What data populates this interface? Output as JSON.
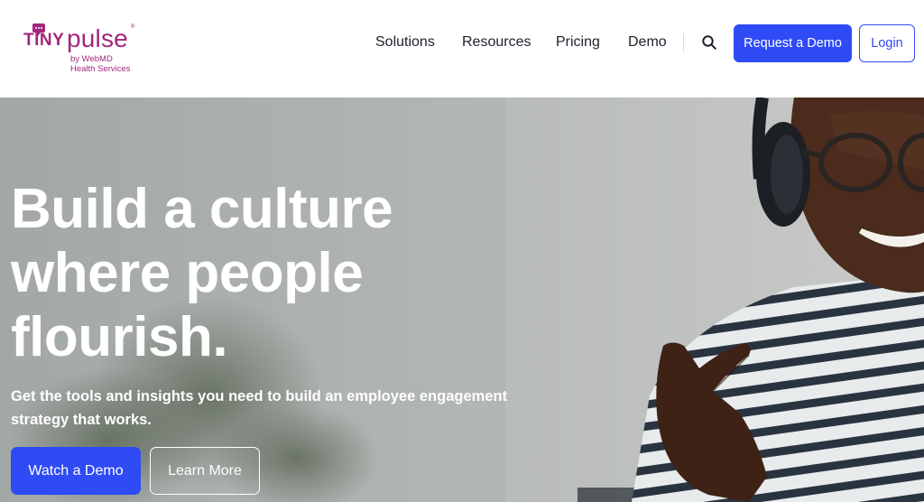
{
  "brand": {
    "logo_word_1": "TINY",
    "logo_word_2": "pulse",
    "logo_mark": "®",
    "logo_by_line_1": "by WebMD",
    "logo_by_line_2": "Health Services",
    "color": "#a3267e"
  },
  "nav": {
    "items": [
      {
        "label": "Solutions"
      },
      {
        "label": "Resources"
      },
      {
        "label": "Pricing"
      },
      {
        "label": "Demo"
      }
    ],
    "search_icon": "search-icon",
    "request_demo_label": "Request a Demo",
    "login_label": "Login"
  },
  "hero": {
    "title_lines": [
      "Build a culture",
      "where people",
      "flourish."
    ],
    "subtitle": "Get the tools and insights you need to build an employee engagement strategy that works.",
    "primary_cta": "Watch a Demo",
    "secondary_cta": "Learn More"
  },
  "colors": {
    "accent": "#2f4bf5",
    "text": "#1f1f2e",
    "hero_text": "#ffffff"
  }
}
